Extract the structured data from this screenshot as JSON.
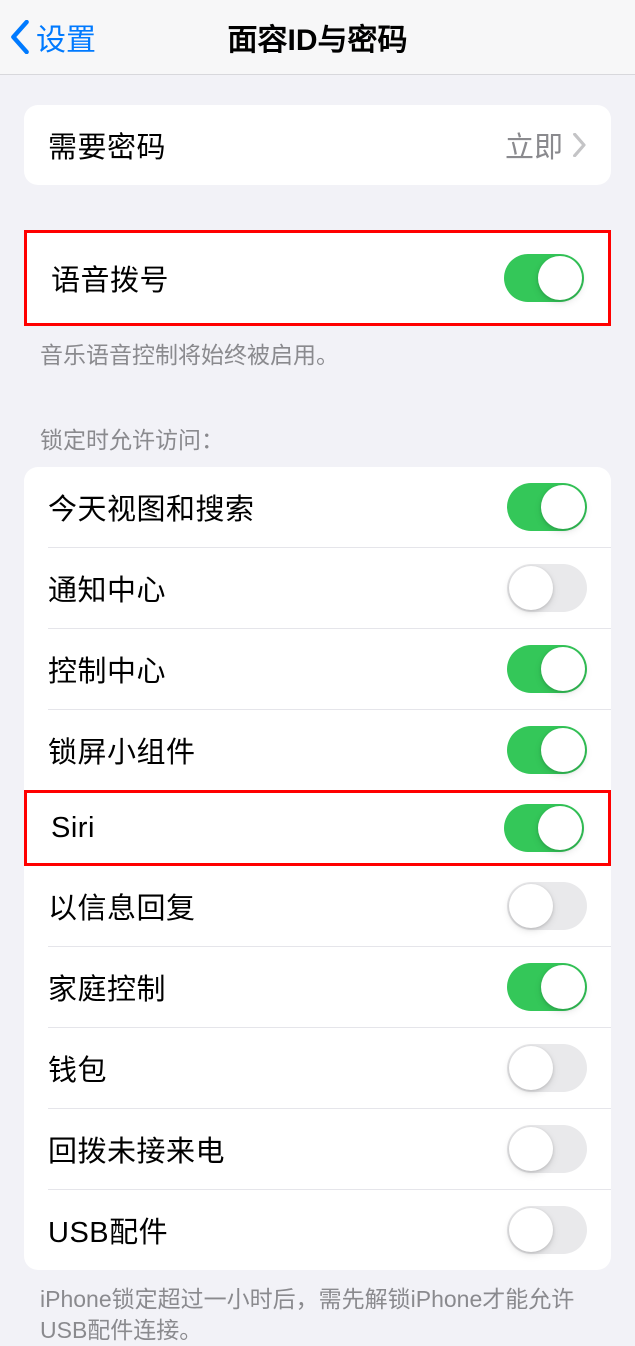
{
  "nav": {
    "back_label": "设置",
    "title": "面容ID与密码"
  },
  "require_passcode": {
    "label": "需要密码",
    "value": "立即"
  },
  "voice_dial": {
    "label": "语音拨号",
    "on": true,
    "footer": "音乐语音控制将始终被启用。"
  },
  "lock_access": {
    "header": "锁定时允许访问：",
    "items": [
      {
        "label": "今天视图和搜索",
        "on": true
      },
      {
        "label": "通知中心",
        "on": false
      },
      {
        "label": "控制中心",
        "on": true
      },
      {
        "label": "锁屏小组件",
        "on": true
      },
      {
        "label": "Siri",
        "on": true,
        "highlight": true
      },
      {
        "label": "以信息回复",
        "on": false
      },
      {
        "label": "家庭控制",
        "on": true
      },
      {
        "label": "钱包",
        "on": false
      },
      {
        "label": "回拨未接来电",
        "on": false
      },
      {
        "label": "USB配件",
        "on": false
      }
    ],
    "footer": "iPhone锁定超过一小时后，需先解锁iPhone才能允许USB配件连接。"
  }
}
